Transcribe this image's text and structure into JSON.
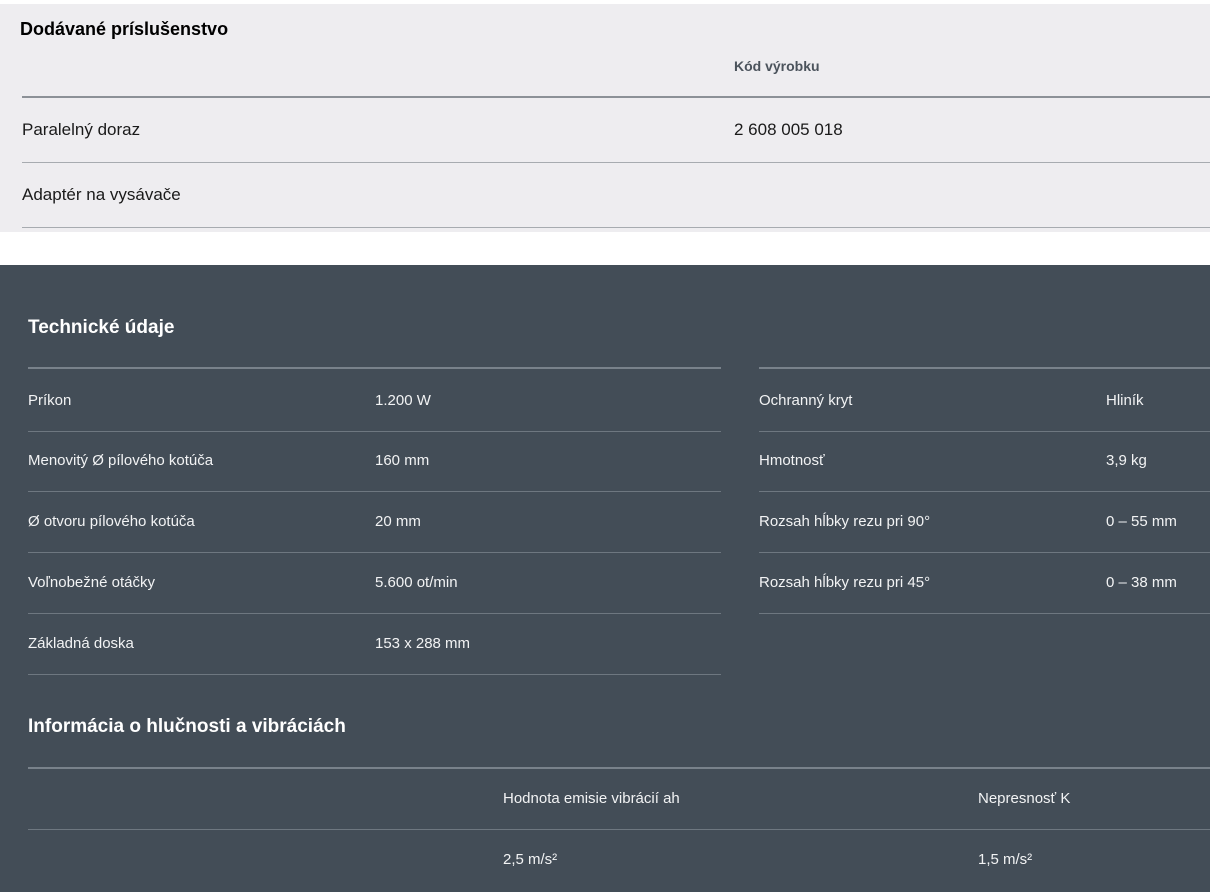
{
  "accessories": {
    "title": "Dodávané príslušenstvo",
    "column_header": "Kód výrobku",
    "rows": [
      {
        "name": "Paralelný doraz",
        "code": "2 608 005 018"
      },
      {
        "name": "Adaptér na vysávače",
        "code": ""
      }
    ]
  },
  "tech": {
    "title": "Technické údaje",
    "left_rows": [
      {
        "label": "Príkon",
        "value": "1.200 W"
      },
      {
        "label": "Menovitý Ø pílového kotúča",
        "value": "160 mm"
      },
      {
        "label": "Ø otvoru pílového kotúča",
        "value": "20 mm"
      },
      {
        "label": "Voľnobežné otáčky",
        "value": "5.600 ot/min"
      },
      {
        "label": "Základná doska",
        "value": "153 x 288 mm"
      }
    ],
    "right_rows": [
      {
        "label": "Ochranný kryt",
        "value": "Hliník"
      },
      {
        "label": "Hmotnosť",
        "value": "3,9 kg"
      },
      {
        "label": "Rozsah hĺbky rezu pri 90°",
        "value": "0 – 55 mm"
      },
      {
        "label": "Rozsah hĺbky rezu pri 45°",
        "value": "0 – 38 mm"
      }
    ]
  },
  "noise": {
    "title": "Informácia o hlučnosti a vibráciách",
    "headers": [
      "Hodnota emisie vibrácií ah",
      "Nepresnosť K"
    ],
    "values": [
      "2,5 m/s²",
      "1,5 m/s²"
    ]
  }
}
